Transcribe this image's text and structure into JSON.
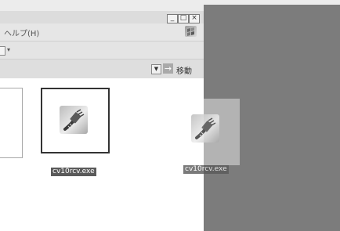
{
  "window": {
    "controls": {
      "minimize": "_",
      "maximize": "□",
      "close": "×"
    },
    "menu": {
      "help_label": "ヘルプ(H)"
    },
    "toolbar": {
      "dropdown_arrow": "▾"
    },
    "addressbar": {
      "dropdown_arrow": "▼",
      "go_arrow": "→",
      "go_label": "移動"
    },
    "logo_icon": "windows-flag-icon"
  },
  "file": {
    "name": "cv10rcv.exe",
    "icon": "network-cable-plug-icon",
    "selected": true
  },
  "drag": {
    "name": "cv10rcv.exe",
    "icon": "network-cable-plug-icon"
  },
  "colors": {
    "selection_border": "#333333",
    "label_background": "#5a5a5a",
    "desktop_gray": "#7c7c7c"
  }
}
